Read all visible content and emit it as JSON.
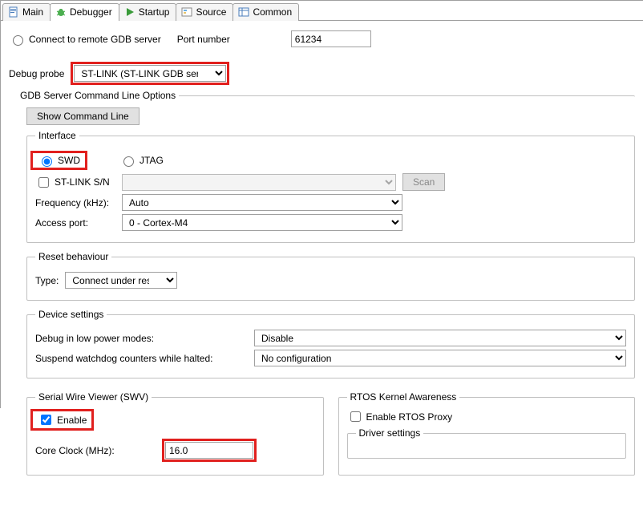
{
  "tabs": {
    "main": "Main",
    "debugger": "Debugger",
    "startup": "Startup",
    "source": "Source",
    "common": "Common"
  },
  "connect_remote": {
    "label": "Connect to remote GDB server",
    "port_label": "Port number",
    "port_value": "61234"
  },
  "debug_probe": {
    "label": "Debug probe",
    "value": "ST-LINK (ST-LINK GDB server)"
  },
  "gdb_server": {
    "legend": "GDB Server Command Line Options",
    "show_cmd": "Show Command Line",
    "interface": {
      "legend": "Interface",
      "swd": "SWD",
      "jtag": "JTAG",
      "stlink_sn_label": "ST-LINK S/N",
      "stlink_sn_value": "",
      "scan": "Scan",
      "freq_label": "Frequency (kHz):",
      "freq_value": "Auto",
      "access_label": "Access port:",
      "access_value": "0 - Cortex-M4"
    },
    "reset": {
      "legend": "Reset behaviour",
      "type_label": "Type:",
      "type_value": "Connect under reset"
    },
    "device": {
      "legend": "Device settings",
      "low_power_label": "Debug in low power modes:",
      "low_power_value": "Disable",
      "watchdog_label": "Suspend watchdog counters while halted:",
      "watchdog_value": "No configuration"
    },
    "swv": {
      "legend": "Serial Wire Viewer (SWV)",
      "enable": "Enable",
      "clock_label": "Core Clock (MHz):",
      "clock_value": "16.0"
    },
    "rtos": {
      "legend": "RTOS Kernel Awareness",
      "enable": "Enable RTOS Proxy",
      "driver_legend": "Driver settings"
    }
  }
}
